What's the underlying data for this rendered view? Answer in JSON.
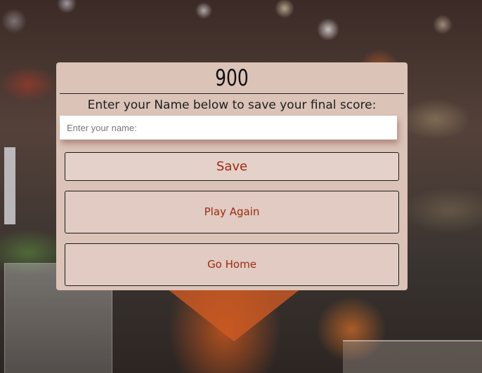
{
  "end_screen": {
    "score": "900",
    "prompt": "Enter your Name below to save your final score:",
    "name_input": {
      "placeholder": "Enter your name:",
      "value": ""
    },
    "buttons": {
      "save": "Save",
      "play_again": "Play Again",
      "go_home": "Go Home"
    }
  },
  "colors": {
    "panel_background": "#dbc3b8",
    "button_text": "#9c2a10",
    "button_border": "#1b1b1b"
  }
}
